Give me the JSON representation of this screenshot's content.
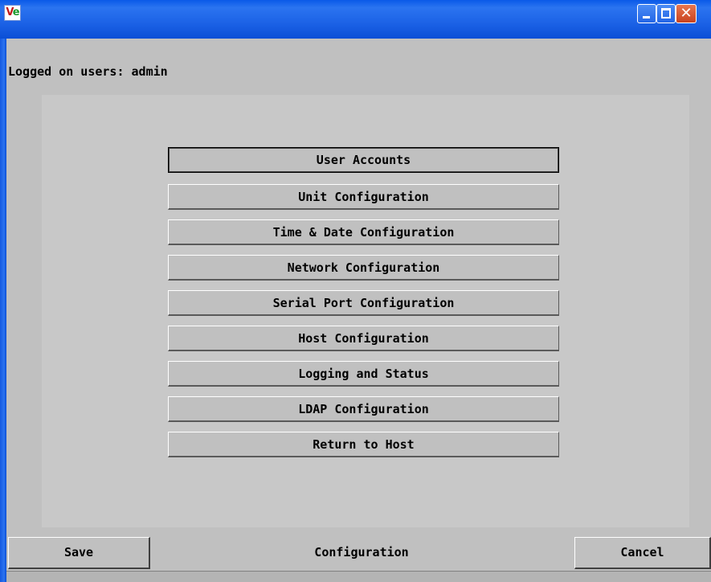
{
  "window": {
    "logo_text_v": "V",
    "logo_text_e": "e",
    "controls": {
      "minimize_icon": "minimize-icon",
      "maximize_icon": "maximize-icon",
      "close_icon": "close-icon",
      "close_glyph": "✕"
    },
    "colors": {
      "titlebar": "#1c62e6",
      "close_button": "#d9582e",
      "background": "#c0c0c0"
    }
  },
  "header": {
    "logged_on_users": "Logged on users: admin"
  },
  "menu": {
    "items": [
      {
        "label": "User Accounts",
        "focused": true
      },
      {
        "label": "Unit Configuration"
      },
      {
        "label": "Time & Date Configuration"
      },
      {
        "label": "Network Configuration"
      },
      {
        "label": "Serial Port Configuration"
      },
      {
        "label": "Host Configuration"
      },
      {
        "label": "Logging and Status"
      },
      {
        "label": "LDAP Configuration"
      },
      {
        "label": "Return to Host"
      }
    ]
  },
  "footer": {
    "save_label": "Save",
    "title": "Configuration",
    "cancel_label": "Cancel"
  }
}
